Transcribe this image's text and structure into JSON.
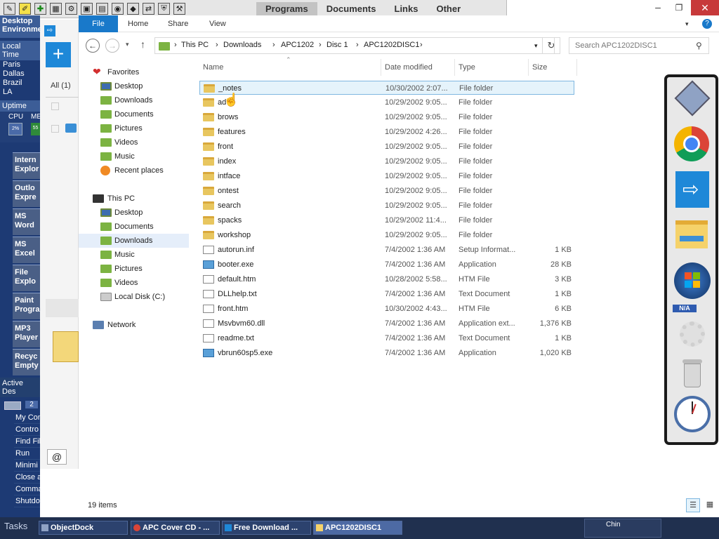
{
  "quickbar": {
    "tabs": [
      "Programs",
      "Documents",
      "Links",
      "Other"
    ]
  },
  "desktop_sidebar": {
    "title": "Desktop Environme",
    "local_time_label": "Local Time",
    "cities": [
      "Paris",
      "Dallas",
      "Brazil",
      "LA"
    ],
    "uptime_label": "Uptime",
    "cpu_label": "CPU",
    "mem_label": "ME",
    "cpu_value": "2%",
    "mem_value": "55",
    "apps": [
      "Intern Explor",
      "Outlo Expre",
      "MS Word",
      "MS Excel",
      "File Explo",
      "Paint Progra",
      "MP3 Player",
      "Recyc Empty"
    ],
    "active_label": "Active Des",
    "page_num": "2",
    "menu": [
      "My Com",
      "Contro",
      "Find Fil",
      "Run",
      "Minimi",
      "Close all",
      "Command Line",
      "Shutdown"
    ]
  },
  "mini_panel": {
    "tab": "All (1)"
  },
  "ribbon": {
    "tabs": [
      "File",
      "Home",
      "Share",
      "View"
    ]
  },
  "window": {
    "title_controls": [
      "minimize",
      "restore",
      "close"
    ]
  },
  "address": {
    "crumbs": [
      "This PC",
      "Downloads",
      "APC1202",
      "Disc 1",
      "APC1202DISC1"
    ],
    "search_placeholder": "Search APC1202DISC1"
  },
  "navpane": {
    "favorites_label": "Favorites",
    "favorites": [
      "Desktop",
      "Downloads",
      "Documents",
      "Pictures",
      "Videos",
      "Music",
      "Recent places"
    ],
    "thispc_label": "This PC",
    "thispc": [
      "Desktop",
      "Documents",
      "Downloads",
      "Music",
      "Pictures",
      "Videos",
      "Local Disk (C:)"
    ],
    "network_label": "Network"
  },
  "columns": {
    "name": "Name",
    "date": "Date modified",
    "type": "Type",
    "size": "Size"
  },
  "files": [
    {
      "name": "_notes",
      "date": "10/30/2002 2:07...",
      "type": "File folder",
      "size": "",
      "kind": "folder"
    },
    {
      "name": "ad",
      "date": "10/29/2002 9:05...",
      "type": "File folder",
      "size": "",
      "kind": "folder"
    },
    {
      "name": "brows",
      "date": "10/29/2002 9:05...",
      "type": "File folder",
      "size": "",
      "kind": "folder"
    },
    {
      "name": "features",
      "date": "10/29/2002 4:26...",
      "type": "File folder",
      "size": "",
      "kind": "folder"
    },
    {
      "name": "front",
      "date": "10/29/2002 9:05...",
      "type": "File folder",
      "size": "",
      "kind": "folder"
    },
    {
      "name": "index",
      "date": "10/29/2002 9:05...",
      "type": "File folder",
      "size": "",
      "kind": "folder"
    },
    {
      "name": "intface",
      "date": "10/29/2002 9:05...",
      "type": "File folder",
      "size": "",
      "kind": "folder"
    },
    {
      "name": "ontest",
      "date": "10/29/2002 9:05...",
      "type": "File folder",
      "size": "",
      "kind": "folder"
    },
    {
      "name": "search",
      "date": "10/29/2002 9:05...",
      "type": "File folder",
      "size": "",
      "kind": "folder"
    },
    {
      "name": "spacks",
      "date": "10/29/2002 11:4...",
      "type": "File folder",
      "size": "",
      "kind": "folder"
    },
    {
      "name": "workshop",
      "date": "10/29/2002 9:05...",
      "type": "File folder",
      "size": "",
      "kind": "folder"
    },
    {
      "name": "autorun.inf",
      "date": "7/4/2002 1:36 AM",
      "type": "Setup Informat...",
      "size": "1 KB",
      "kind": "file"
    },
    {
      "name": "booter.exe",
      "date": "7/4/2002 1:36 AM",
      "type": "Application",
      "size": "28 KB",
      "kind": "app"
    },
    {
      "name": "default.htm",
      "date": "10/28/2002 5:58...",
      "type": "HTM File",
      "size": "3 KB",
      "kind": "file"
    },
    {
      "name": "DLLhelp.txt",
      "date": "7/4/2002 1:36 AM",
      "type": "Text Document",
      "size": "1 KB",
      "kind": "file"
    },
    {
      "name": "front.htm",
      "date": "10/30/2002 4:43...",
      "type": "HTM File",
      "size": "6 KB",
      "kind": "file"
    },
    {
      "name": "Msvbvm60.dll",
      "date": "7/4/2002 1:36 AM",
      "type": "Application ext...",
      "size": "1,376 KB",
      "kind": "file"
    },
    {
      "name": "readme.txt",
      "date": "7/4/2002 1:36 AM",
      "type": "Text Document",
      "size": "1 KB",
      "kind": "file"
    },
    {
      "name": "vbrun60sp5.exe",
      "date": "7/4/2002 1:36 AM",
      "type": "Application",
      "size": "1,020 KB",
      "kind": "app"
    }
  ],
  "status": {
    "count": "19 items"
  },
  "taskbar": {
    "label": "Tasks",
    "items": [
      "ObjectDock",
      "APC Cover CD - ...",
      "Free Download ...",
      "APC1202DISC1"
    ],
    "tray": "Chin"
  },
  "dock": {
    "items": [
      "objectdock-icon",
      "chrome-icon",
      "free-download-icon",
      "file-explorer-icon",
      "windows-icon",
      "settings-icon",
      "recycle-bin-icon",
      "clock-icon"
    ],
    "na_label": "N/A"
  }
}
